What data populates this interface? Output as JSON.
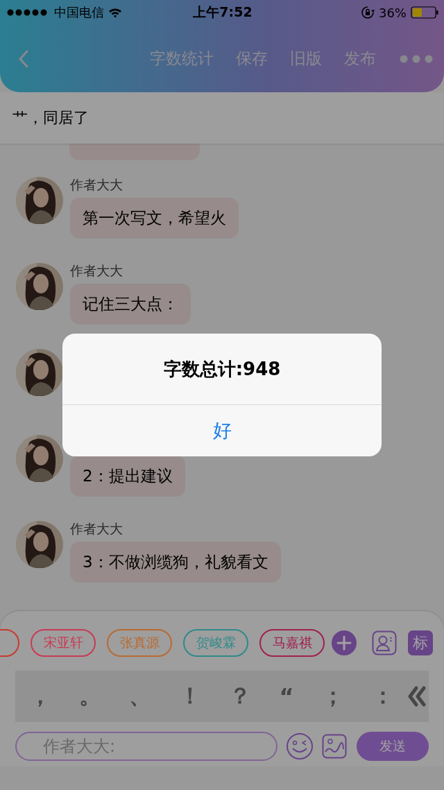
{
  "status_bar": {
    "carrier": "中国电信",
    "time": "上午7:52",
    "battery": "36%"
  },
  "nav": {
    "actions": [
      "字数统计",
      "保存",
      "旧版",
      "发布"
    ]
  },
  "title": "艹，同居了",
  "messages": [
    {
      "kind": "message",
      "author": "作者大大",
      "text": "第一次写文，希望火"
    },
    {
      "kind": "message",
      "author": "作者大大",
      "text": "记住三大点："
    },
    {
      "kind": "avatar"
    },
    {
      "kind": "message",
      "text": "2：提出建议"
    },
    {
      "kind": "message",
      "author": "作者大大",
      "text": "3：不做浏缆狗，礼貌看文"
    }
  ],
  "tags": [
    {
      "color": "#c83a30"
    },
    {
      "label": "宋亚轩",
      "color": "#c83a55"
    },
    {
      "label": "张真源",
      "color": "#b86a30"
    },
    {
      "label": "贺峻霖",
      "color": "#2f8a8a"
    },
    {
      "label": "马嘉祺",
      "color": "#a02050"
    }
  ],
  "tag_button": "标",
  "punctuation": [
    "，",
    "。",
    "、",
    "！",
    "？",
    "“",
    "；",
    "："
  ],
  "input": {
    "placeholder": "作者大大:"
  },
  "send": "发送",
  "dialog": {
    "message": "字数总计:948",
    "button": "好"
  }
}
